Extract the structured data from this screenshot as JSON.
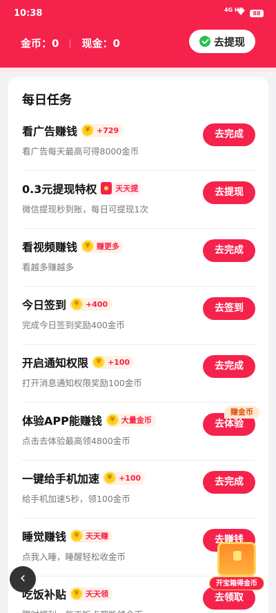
{
  "status_bar": {
    "time": "10:38",
    "network": "4G HD",
    "battery": "88"
  },
  "header": {
    "gold_label": "金币：0",
    "cash_label": "现金：0",
    "withdraw_button": "去提现",
    "accent_color": "#f5224b"
  },
  "tasks_card": {
    "title": "每日任务",
    "tasks": [
      {
        "name": "看广告赚钱",
        "badge_icon": "coin-icon",
        "badge": "+729",
        "desc": "看广告每天最高可得8000金币",
        "action": "去完成"
      },
      {
        "name": "0.3元提现特权",
        "badge_icon": "red-packet-icon",
        "badge": "天天提",
        "desc": "微信提现秒到账，每日可提现1次",
        "action": "去提现"
      },
      {
        "name": "看视频赚钱",
        "badge_icon": "coin-icon",
        "badge": "赚更多",
        "desc": "看越多赚越多",
        "action": "去完成"
      },
      {
        "name": "今日签到",
        "badge_icon": "coin-icon",
        "badge": "+400",
        "desc": "完成今日签到奖励400金币",
        "action": "去签到"
      },
      {
        "name": "开启通知权限",
        "badge_icon": "coin-icon",
        "badge": "+100",
        "desc": "打开消息通知权限奖励100金币",
        "action": "去完成"
      },
      {
        "name": "体验APP能赚钱",
        "badge_icon": "coin-icon",
        "badge": "大量金币",
        "desc": "点击去体验最高领4800金币",
        "action": "去体验",
        "tag": "赚金币"
      },
      {
        "name": "一键给手机加速",
        "badge_icon": "coin-icon",
        "badge": "+100",
        "desc": "给手机加速5秒，领100金币",
        "action": "去完成"
      },
      {
        "name": "睡觉赚钱",
        "badge_icon": "coin-icon",
        "badge": "天天赚",
        "desc": "点我入睡，睡醒轻松收金币",
        "action": "去赚钱"
      },
      {
        "name": "吃饭补贴",
        "badge_icon": "coin-icon",
        "badge": "天天领",
        "desc": "限时福利，每天饭点都能领金币",
        "action": "去领取"
      }
    ]
  },
  "float": {
    "back_icon": "chevron-left-icon",
    "treasure_label": "开宝箱得金币"
  }
}
